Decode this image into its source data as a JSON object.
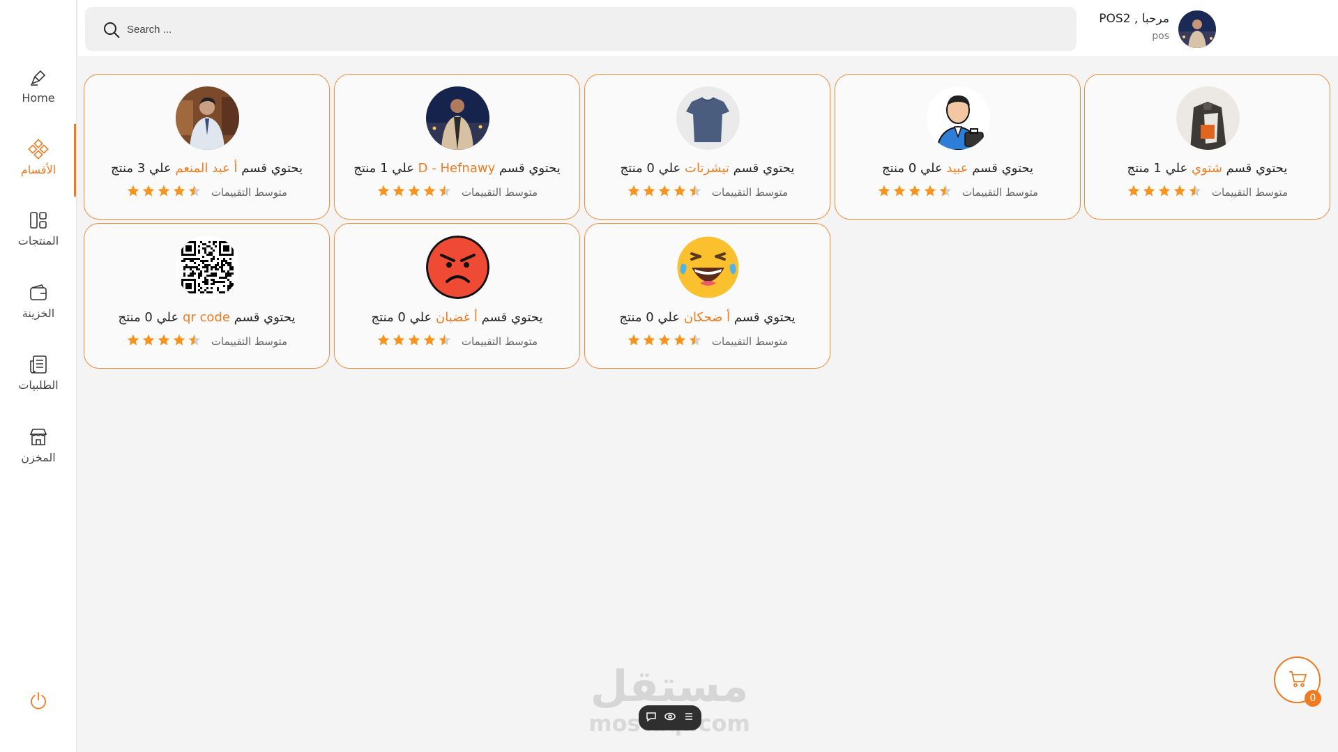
{
  "colors": {
    "accent": "#f07a1f",
    "star": "#f7941d",
    "card_border": "#f08a34"
  },
  "header": {
    "search_placeholder": "Search ...",
    "greeting": "مرحبا , POS2",
    "role": "pos"
  },
  "sidebar": {
    "items": [
      {
        "label": "Home",
        "icon": "pen-icon",
        "active": false
      },
      {
        "label": "الأقسام",
        "icon": "categories-icon",
        "active": true
      },
      {
        "label": "المنتجات",
        "icon": "grid-icon",
        "active": false
      },
      {
        "label": "الخزينة",
        "icon": "wallet-icon",
        "active": false
      },
      {
        "label": "الطلبيات",
        "icon": "orders-icon",
        "active": false
      },
      {
        "label": "المخزن",
        "icon": "store-icon",
        "active": false
      }
    ]
  },
  "card_text": {
    "prefix": "يحتوي قسم",
    "middle": "علي",
    "suffix": "منتج",
    "rating_label": "متوسط التقييمات"
  },
  "categories": [
    {
      "name": "شتوي",
      "count": "1",
      "rating": 4.5,
      "image": "clothes-photo"
    },
    {
      "name": "عبيد",
      "count": "0",
      "rating": 4.5,
      "image": "businessman-illustration"
    },
    {
      "name": "تيشرتات",
      "count": "0",
      "rating": 4.5,
      "image": "tshirt-photo"
    },
    {
      "name": "D - Hefnawy",
      "count": "1",
      "rating": 4.5,
      "image": "person-photo"
    },
    {
      "name": "أ عبد المنعم",
      "count": "3",
      "rating": 4.5,
      "image": "person-photo-2"
    },
    {
      "name": "أ ضحكان",
      "count": "0",
      "rating": 4.5,
      "image": "laughing-emoji"
    },
    {
      "name": "أ غضبان",
      "count": "0",
      "rating": 4.5,
      "image": "angry-emoji"
    },
    {
      "name": "qr code",
      "count": "0",
      "rating": 4.5,
      "image": "qr-code"
    }
  ],
  "cart": {
    "count": "0"
  },
  "watermark": {
    "arabic": "مستقل",
    "latin": "mostaql.com"
  }
}
